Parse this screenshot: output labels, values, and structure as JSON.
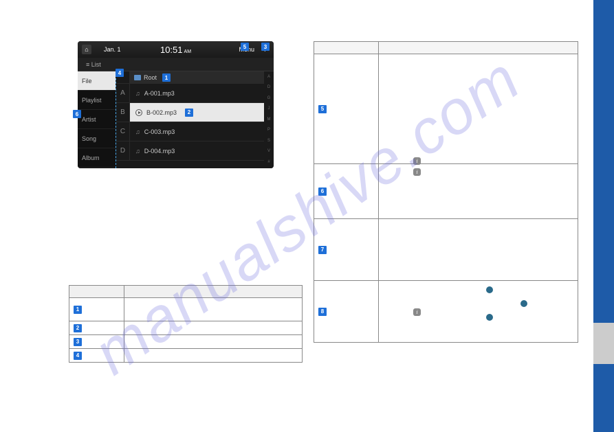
{
  "watermark": "manualshive.com",
  "screenshot": {
    "date": "Jan.  1",
    "time": "10:51",
    "ampm": "AM",
    "menu": "Menu",
    "back": "↩",
    "list_label": "≡ List",
    "root": "Root",
    "sidebar": [
      "File",
      "Playlist",
      "Artist",
      "Song",
      "Album"
    ],
    "letters": [
      "A",
      "B",
      "C",
      "D"
    ],
    "files": [
      "A-001.mp3",
      "B-002.mp3",
      "C-003.mp3",
      "D-004.mp3"
    ],
    "index_letters": [
      "A",
      "D",
      "G",
      "J",
      "M",
      "P",
      "S",
      "V",
      "#"
    ]
  },
  "callouts": {
    "c1": "1",
    "c2": "2",
    "c3": "3",
    "c4": "4",
    "c5": "5",
    "c6": "6",
    "c7": "7",
    "c8": "8"
  },
  "info": "i"
}
